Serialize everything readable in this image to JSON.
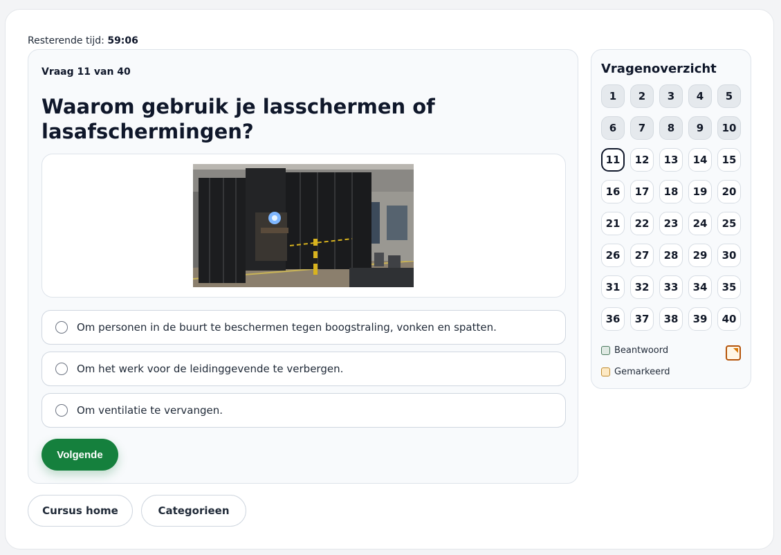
{
  "timer": {
    "label": "Resterende tijd:",
    "value": "59:06"
  },
  "question": {
    "counter": "Vraag 11 van 40",
    "title": "Waarom gebruik je lasschermen of lasafschermingen?",
    "options": [
      "Om personen in de buurt te beschermen tegen boogstraling, vonken en spatten.",
      "Om het werk voor de leidinggevende te verbergen.",
      "Om ventilatie te vervangen."
    ],
    "next_label": "Volgende"
  },
  "overview": {
    "title": "Vragenoverzicht",
    "numbers": [
      "1",
      "2",
      "3",
      "4",
      "5",
      "6",
      "7",
      "8",
      "9",
      "10",
      "11",
      "12",
      "13",
      "14",
      "15",
      "16",
      "17",
      "18",
      "19",
      "20",
      "21",
      "22",
      "23",
      "24",
      "25",
      "26",
      "27",
      "28",
      "29",
      "30",
      "31",
      "32",
      "33",
      "34",
      "35",
      "36",
      "37",
      "38",
      "39",
      "40"
    ],
    "answered_count": 10,
    "current": 11,
    "legend": {
      "answered": "Beantwoord",
      "marked": "Gemarkeerd"
    }
  },
  "footer": {
    "home_label": "Cursus home",
    "categories_label": "Categorieen"
  },
  "colors": {
    "primary": "#15803d",
    "mark": "#b45309",
    "current_border": "#0f172a"
  },
  "icons": {
    "flag": "mark-flag-icon",
    "radio": "radio-circle-icon"
  }
}
